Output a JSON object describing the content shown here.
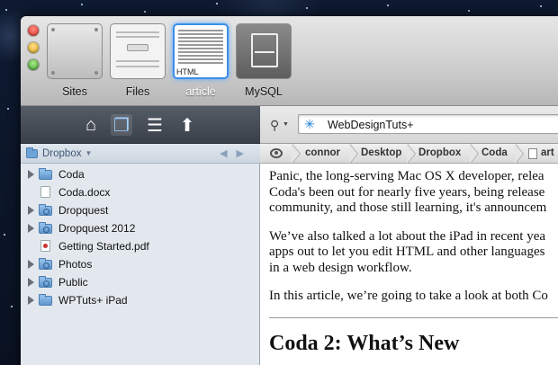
{
  "toolbar": {
    "items": [
      {
        "label": "Sites"
      },
      {
        "label": "Files"
      },
      {
        "label": "article",
        "badge": "HTML"
      },
      {
        "label": "MySQL"
      }
    ]
  },
  "sidebar": {
    "tab_icons": [
      "home-icon",
      "files-icon",
      "editor-icon",
      "publish-icon"
    ],
    "location": "Dropbox",
    "tree": [
      {
        "name": "Coda",
        "type": "folder",
        "expandable": true
      },
      {
        "name": "Coda.docx",
        "type": "file",
        "expandable": false
      },
      {
        "name": "Dropquest",
        "type": "folder-special",
        "expandable": true
      },
      {
        "name": "Dropquest 2012",
        "type": "folder-special",
        "expandable": true
      },
      {
        "name": "Getting Started.pdf",
        "type": "pdf",
        "expandable": false
      },
      {
        "name": "Photos",
        "type": "folder-special",
        "expandable": true
      },
      {
        "name": "Public",
        "type": "folder-special",
        "expandable": true
      },
      {
        "name": "WPTuts+ iPad",
        "type": "folder",
        "expandable": true
      }
    ]
  },
  "main": {
    "search_value": "WebDesignTuts+",
    "breadcrumbs": [
      "connor",
      "Desktop",
      "Dropbox",
      "Coda",
      "art"
    ],
    "paragraphs": [
      [
        "Panic, the long-serving Mac OS X developer, relea",
        "Coda's been out for nearly five years, being release",
        "community, and those still learning, it's announcem"
      ],
      [
        "We’ve also talked a lot about the iPad in recent yea",
        "apps out to let you edit HTML and other languages",
        "in a web design workflow."
      ],
      [
        "In this article, we’re going to take a look at both Co"
      ]
    ],
    "heading": "Coda 2: What’s New"
  }
}
